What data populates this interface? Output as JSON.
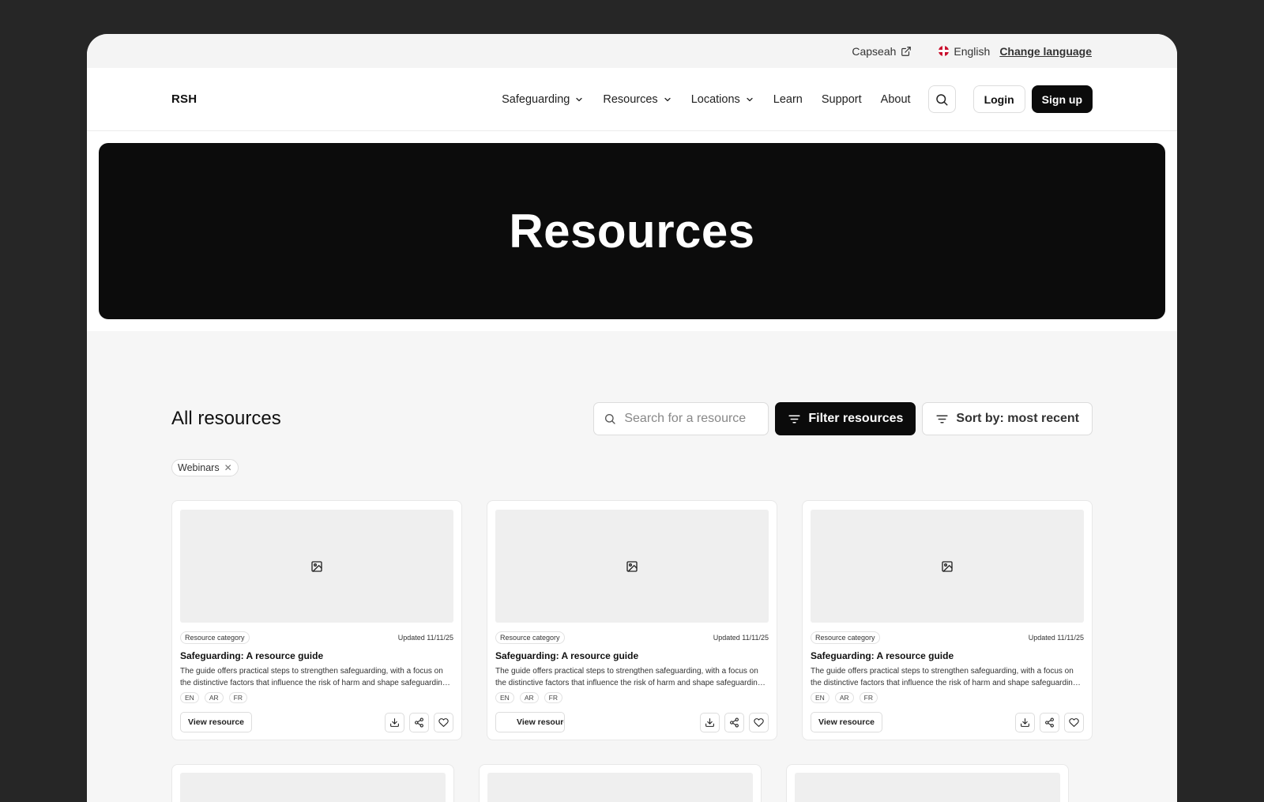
{
  "utility": {
    "partner_link": "Capseah",
    "language": "English",
    "change_language": "Change language"
  },
  "nav": {
    "logo": "RSH",
    "items": [
      {
        "label": "Safeguarding",
        "dropdown": true
      },
      {
        "label": "Resources",
        "dropdown": true
      },
      {
        "label": "Locations",
        "dropdown": true
      },
      {
        "label": "Learn",
        "dropdown": false
      },
      {
        "label": "Support",
        "dropdown": false
      },
      {
        "label": "About",
        "dropdown": false
      }
    ],
    "login": "Login",
    "signup": "Sign up"
  },
  "hero": {
    "title": "Resources"
  },
  "resources": {
    "heading": "All resources",
    "search_placeholder": "Search for a resource",
    "filter_label": "Filter resources",
    "sort_label": "Sort by: most recent",
    "active_filters": [
      "Webinars"
    ],
    "cards": [
      {
        "category": "Resource category",
        "updated": "Updated 11/11/25",
        "title": "Safeguarding: A resource guide",
        "description": "The guide offers practical steps to strengthen safeguarding, with a focus on the distinctive factors that influence the risk of harm and shape safeguarding practice.",
        "languages": [
          "EN",
          "AR",
          "FR"
        ],
        "button": "View resource"
      },
      {
        "category": "Resource category",
        "updated": "Updated 11/11/25",
        "title": "Safeguarding: A resource guide",
        "description": "The guide offers practical steps to strengthen safeguarding, with a focus on the distinctive factors that influence the risk of harm and shape safeguarding practice.",
        "languages": [
          "EN",
          "AR",
          "FR"
        ],
        "button": "View resource"
      },
      {
        "category": "Resource category",
        "updated": "Updated 11/11/25",
        "title": "Safeguarding: A resource guide",
        "description": "The guide offers practical steps to strengthen safeguarding, with a focus on the distinctive factors that influence the risk of harm and shape safeguarding practice.",
        "languages": [
          "EN",
          "AR",
          "FR"
        ],
        "button": "View resource"
      }
    ]
  }
}
